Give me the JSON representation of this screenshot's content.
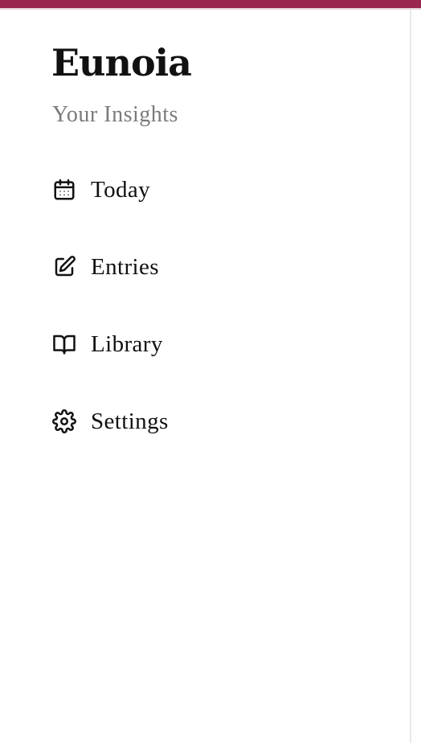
{
  "header": {
    "app_title": "Eunoia",
    "subtitle": "Your Insights"
  },
  "colors": {
    "accent": "#9a2650",
    "text": "#111111",
    "muted": "#7a7a7a"
  },
  "nav": {
    "items": [
      {
        "label": "Today",
        "icon": "calendar-icon"
      },
      {
        "label": "Entries",
        "icon": "edit-icon"
      },
      {
        "label": "Library",
        "icon": "book-open-icon"
      },
      {
        "label": "Settings",
        "icon": "gear-icon"
      }
    ]
  }
}
